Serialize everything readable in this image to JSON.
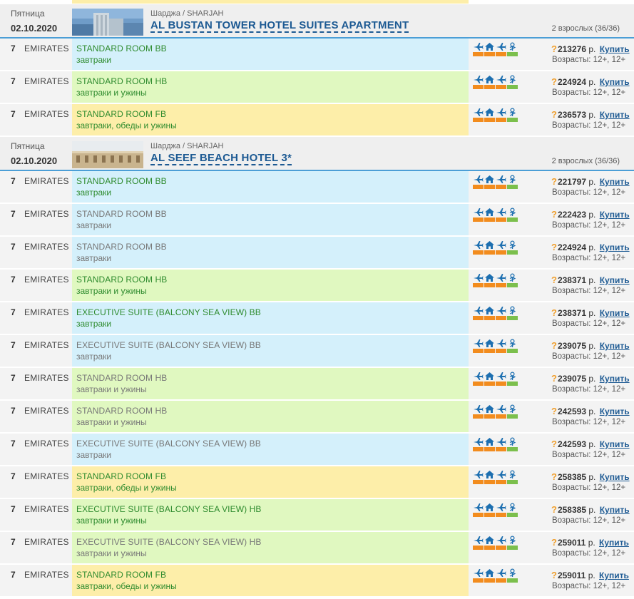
{
  "common": {
    "nights": "7",
    "airline": "EMIRATES",
    "question_mark": "?",
    "currency": "р.",
    "buy_label": "Купить",
    "ages_label": "Возрасты: 12+, 12+"
  },
  "colors": {
    "link": "#1d5a93",
    "header_border": "#4b9ed6",
    "room_blue": "#d4f0fb",
    "room_green": "#e0f8c0",
    "room_yellow": "#fdeea9",
    "status_orange": "#f28c1e",
    "status_green": "#7bbf4c"
  },
  "icons": [
    "plane-icon",
    "house-icon",
    "plane-icon",
    "medical-icon"
  ],
  "hotels": [
    {
      "day": "Пятница",
      "date": "02.10.2020",
      "location": "Шарджа / SHARJAH",
      "name": "AL BUSTAN TOWER HOTEL SUITES APARTMENT",
      "guests": "2 взрослых (36/36)",
      "photo": "tower",
      "rows": [
        {
          "room": "STANDARD ROOM BB",
          "meal": "завтраки",
          "bg": "blue",
          "active": true,
          "price": "213276"
        },
        {
          "room": "STANDARD ROOM HB",
          "meal": "завтраки и ужины",
          "bg": "green",
          "active": true,
          "price": "224924"
        },
        {
          "room": "STANDARD ROOM FB",
          "meal": "завтраки, обеды и ужины",
          "bg": "yellow",
          "active": true,
          "price": "236573"
        }
      ]
    },
    {
      "day": "Пятница",
      "date": "02.10.2020",
      "location": "Шарджа / SHARJAH",
      "name": "AL SEEF BEACH HOTEL 3*",
      "guests": "2 взрослых (36/36)",
      "photo": "building",
      "rows": [
        {
          "room": "STANDARD ROOM BB",
          "meal": "завтраки",
          "bg": "blue",
          "active": true,
          "price": "221797"
        },
        {
          "room": "STANDARD ROOM BB",
          "meal": "завтраки",
          "bg": "blue",
          "active": false,
          "price": "222423"
        },
        {
          "room": "STANDARD ROOM BB",
          "meal": "завтраки",
          "bg": "blue",
          "active": false,
          "price": "224924"
        },
        {
          "room": "STANDARD ROOM HB",
          "meal": "завтраки и ужины",
          "bg": "green",
          "active": true,
          "price": "238371"
        },
        {
          "room": "EXECUTIVE SUITE (BALCONY SEA VIEW) BB",
          "meal": "завтраки",
          "bg": "blue",
          "active": true,
          "price": "238371"
        },
        {
          "room": "EXECUTIVE SUITE (BALCONY SEA VIEW) BB",
          "meal": "завтраки",
          "bg": "blue",
          "active": false,
          "price": "239075"
        },
        {
          "room": "STANDARD ROOM HB",
          "meal": "завтраки и ужины",
          "bg": "green",
          "active": false,
          "price": "239075"
        },
        {
          "room": "STANDARD ROOM HB",
          "meal": "завтраки и ужины",
          "bg": "green",
          "active": false,
          "price": "242593"
        },
        {
          "room": "EXECUTIVE SUITE (BALCONY SEA VIEW) BB",
          "meal": "завтраки",
          "bg": "blue",
          "active": false,
          "price": "242593"
        },
        {
          "room": "STANDARD ROOM FB",
          "meal": "завтраки, обеды и ужины",
          "bg": "yellow",
          "active": true,
          "price": "258385"
        },
        {
          "room": "EXECUTIVE SUITE (BALCONY SEA VIEW) HB",
          "meal": "завтраки и ужины",
          "bg": "green",
          "active": true,
          "price": "258385"
        },
        {
          "room": "EXECUTIVE SUITE (BALCONY SEA VIEW) HB",
          "meal": "завтраки и ужины",
          "bg": "green",
          "active": false,
          "price": "259011"
        },
        {
          "room": "STANDARD ROOM FB",
          "meal": "завтраки, обеды и ужины",
          "bg": "yellow",
          "active": true,
          "price": "259011"
        }
      ]
    }
  ]
}
